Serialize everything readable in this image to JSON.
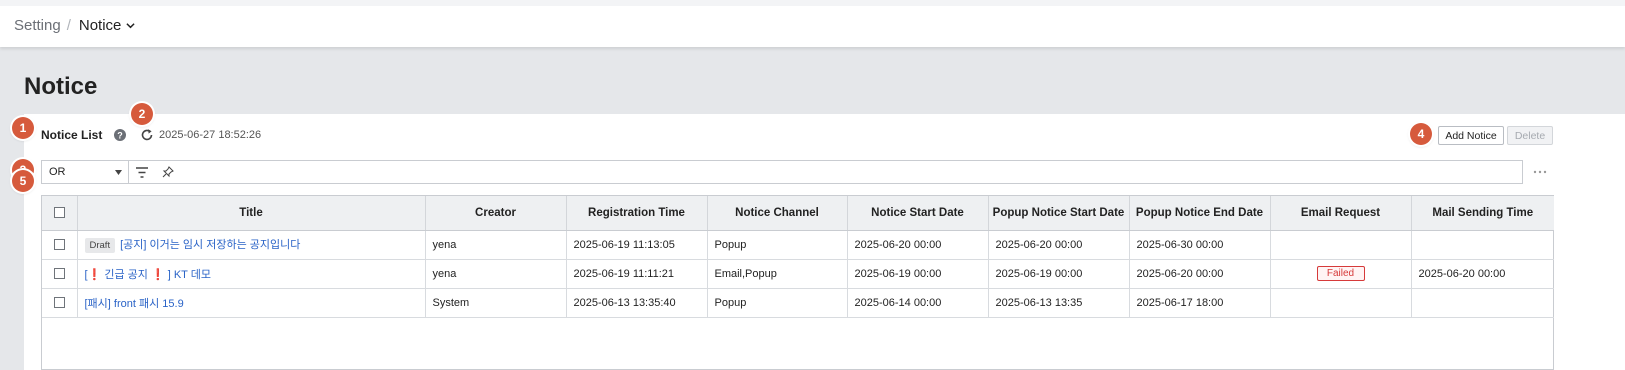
{
  "breadcrumb": {
    "parent": "Setting",
    "separator": "/",
    "current": "Notice"
  },
  "page": {
    "title": "Notice"
  },
  "steps": [
    "1",
    "2",
    "3",
    "4",
    "5"
  ],
  "list": {
    "title": "Notice List",
    "timestamp": "2025-06-27 18:52:26"
  },
  "actions": {
    "add_label": "Add Notice",
    "delete_label": "Delete"
  },
  "filter": {
    "operator": "OR"
  },
  "table": {
    "columns": [
      "Title",
      "Creator",
      "Registration Time",
      "Notice Channel",
      "Notice Start Date",
      "Popup Notice Start Date",
      "Popup Notice End Date",
      "Email Request",
      "Mail Sending Time"
    ],
    "rows": [
      {
        "badge": "Draft",
        "title": "[공지] 이거는 임시 저장하는 공지입니다",
        "creator": "yena",
        "registration_time": "2025-06-19 11:13:05",
        "channel": "Popup",
        "notice_start": "2025-06-20 00:00",
        "popup_start": "2025-06-20 00:00",
        "popup_end": "2025-06-30 00:00",
        "email_request": "",
        "mail_sending_time": ""
      },
      {
        "title_prefix": "[",
        "title_excl1": "❗",
        "title_middle": "긴급 공지",
        "title_excl2": "❗",
        "title_suffix": "] KT 데모",
        "creator": "yena",
        "registration_time": "2025-06-19 11:11:21",
        "channel": "Email,Popup",
        "notice_start": "2025-06-19 00:00",
        "popup_start": "2025-06-19 00:00",
        "popup_end": "2025-06-20 00:00",
        "email_request": "Failed",
        "mail_sending_time": "2025-06-20 00:00"
      },
      {
        "title": "[패시] front 패시 15.9",
        "creator": "System",
        "registration_time": "2025-06-13 13:35:40",
        "channel": "Popup",
        "notice_start": "2025-06-14 00:00",
        "popup_start": "2025-06-13 13:35",
        "popup_end": "2025-06-17 18:00",
        "email_request": "",
        "mail_sending_time": ""
      }
    ]
  },
  "colors": {
    "step_badge": "#d65a3c",
    "link": "#2a63c7",
    "failed": "#d63a3a",
    "background": "#e5e7ea"
  }
}
